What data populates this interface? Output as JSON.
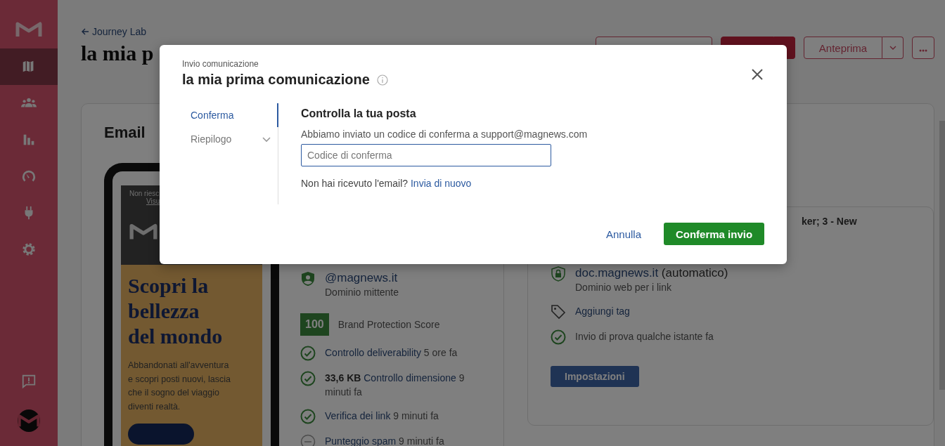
{
  "sidebar": {
    "items": [
      {
        "kind": "map",
        "selected": true
      },
      {
        "kind": "people",
        "selected": false
      },
      {
        "kind": "chart",
        "selected": false
      },
      {
        "kind": "gauge",
        "selected": false
      },
      {
        "kind": "plug",
        "selected": false
      },
      {
        "kind": "gear",
        "selected": false
      }
    ],
    "bottom": [
      {
        "kind": "feedback"
      },
      {
        "kind": "avatar"
      }
    ]
  },
  "header": {
    "back_link": "Journey Lab",
    "title": "la mia p",
    "preview_button": "Anteprima"
  },
  "email_card": {
    "title": "Email",
    "preview": {
      "notice": "Non riesc",
      "view_link": "Visu",
      "headline": "Scopri la bellezza del mondo",
      "body": "Abbandonati all'avventura e scopri posti nuovi, lascia che il sogno del viaggio diventi realtà."
    },
    "checks": [
      {
        "kind": "domain",
        "title": "@magnews.it",
        "subtitle": "Dominio mittente"
      },
      {
        "kind": "score",
        "score": "100",
        "label": "Brand Protection Score"
      },
      {
        "kind": "status",
        "passed": true,
        "label": "Controllo deliverability",
        "time": "5 ore fa"
      },
      {
        "kind": "status",
        "passed": true,
        "prefix": "33,6 KB",
        "label": "Controllo dimensione",
        "time": "9 minuti fa"
      },
      {
        "kind": "status",
        "passed": true,
        "label": "Verifica dei link",
        "time": "9 minuti fa"
      },
      {
        "kind": "status",
        "passed": false,
        "label": "Punteggio spam",
        "time": "9 minuti fa"
      }
    ],
    "settings": {
      "fragment": "ker; 3 - New",
      "items": [
        {
          "kind": "web_domain",
          "domain": "doc.magnews.it",
          "note": "(automatico)",
          "subtitle": "Dominio web per i link"
        },
        {
          "kind": "tag",
          "label": "Aggiungi tag"
        },
        {
          "kind": "test",
          "label": "Invio di prova qualche istante fa"
        }
      ],
      "button": "Impostazioni"
    }
  },
  "modal": {
    "eyebrow": "Invio comunicazione",
    "title": "la mia prima comunicazione",
    "steps": [
      {
        "label": "Conferma",
        "selected": true,
        "expandable": false
      },
      {
        "label": "Riepilogo",
        "selected": false,
        "expandable": true
      }
    ],
    "heading": "Controlla la tua posta",
    "message": "Abbiamo inviato un codice di conferma a support@magnews.com",
    "code_field": {
      "placeholder": "Codice di conferma"
    },
    "resend": {
      "text": "Non hai ricevuto l'email?",
      "link": "Invia di nuovo"
    },
    "cancel": "Annulla",
    "confirm": "Conferma invio"
  }
}
